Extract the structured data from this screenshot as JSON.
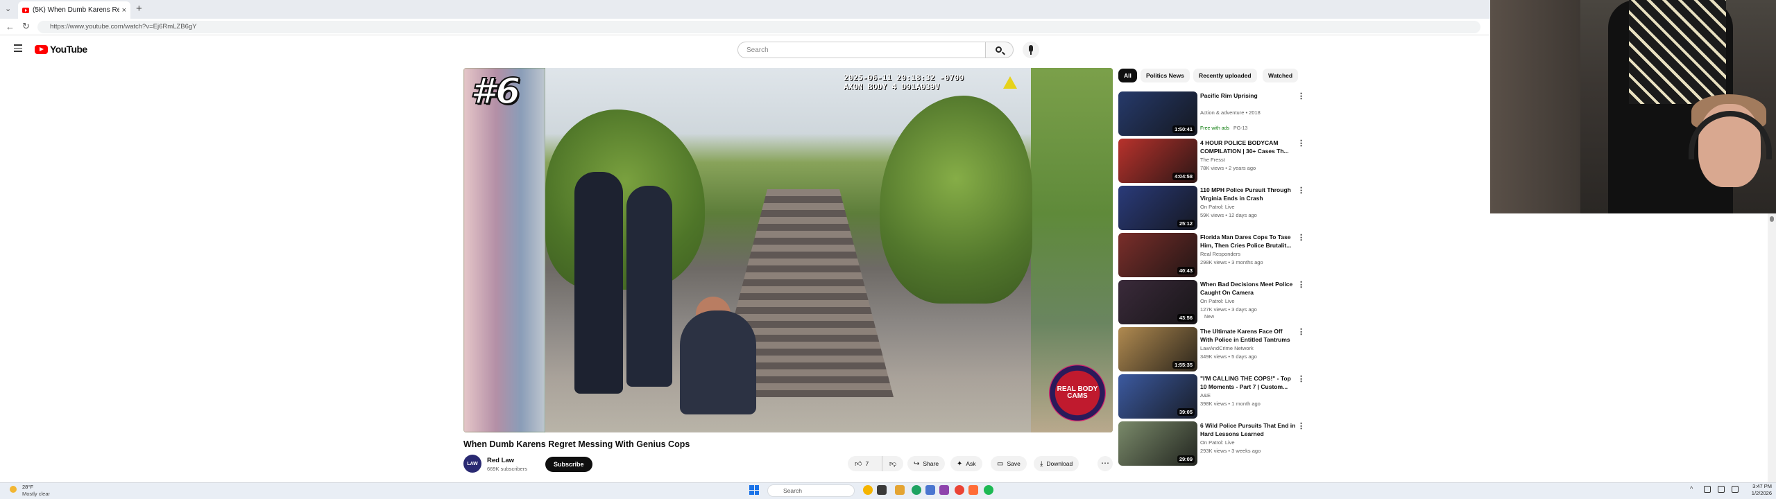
{
  "browser": {
    "tab_menu_glyph": "⌄",
    "active_tab_title": "(5K) When Dumb Karens Re...",
    "tab_close_glyph": "×",
    "new_tab_glyph": "+",
    "back_glyph": "←",
    "reload_glyph": "↻",
    "url": "https://www.youtube.com/watch?v=Ej6RmLZB6gY"
  },
  "youtube": {
    "logo_text": "YouTube",
    "search_placeholder": "Search",
    "video": {
      "rank_text": "#6",
      "overlay_text": "2025-06-11 20:18:32 -0700\nAXON BODY 4 D01A039V",
      "watermark_text": "REAL BODY CAMS",
      "title": "When Dumb Karens Regret Messing With Genius Cops",
      "channel_avatar_text": "LAW",
      "channel_name": "Red Law",
      "channel_subs": "669K subscribers",
      "subscribe_label": "Subscribe",
      "like_count": "7",
      "share_label": "Share",
      "ask_label": "Ask",
      "save_label": "Save",
      "download_label": "Download",
      "more_glyph": "⋯"
    },
    "chips": [
      "All",
      "Politics News",
      "Recently uploaded",
      "Watched"
    ],
    "recommendations": [
      {
        "title": "Pacific Rim Uprising",
        "channel": "Action & adventure • 2018",
        "meta": "",
        "badge_free": "Free with ads",
        "badge_extra": "PG-13",
        "duration": "1:50:41",
        "thumb_color": "#263a6b"
      },
      {
        "title": "4 HOUR POLICE BODYCAM COMPILATION | 30+ Cases Th...",
        "channel": "The Fresst",
        "meta": "78K views • 2 years ago",
        "badge_free": "",
        "badge_extra": "",
        "duration": "4:04:58",
        "thumb_color": "#b8322c"
      },
      {
        "title": "110 MPH Police Pursuit Through Virginia Ends in Crash",
        "channel": "On Patrol: Live",
        "meta": "59K views • 12 days ago",
        "badge_free": "",
        "badge_extra": "",
        "duration": "25:12",
        "thumb_color": "#2a3b7a"
      },
      {
        "title": "Florida Man Dares Cops To Tase Him, Then Cries Police Brutalit...",
        "channel": "Real Responders",
        "meta": "298K views • 3 months ago",
        "badge_free": "",
        "badge_extra": "",
        "duration": "40:43",
        "thumb_color": "#7a2e2a"
      },
      {
        "title": "When Bad Decisions Meet Police Caught On Camera",
        "channel": "On Patrol: Live",
        "meta": "127K views • 3 days ago",
        "badge_free": "",
        "badge_extra": "New",
        "duration": "43:56",
        "thumb_color": "#3a2a3a"
      },
      {
        "title": "The Ultimate Karens Face Off With Police in Entitled Tantrums",
        "channel": "LawAndCrime Network",
        "meta": "349K views • 5 days ago",
        "badge_free": "",
        "badge_extra": "",
        "duration": "1:55:35",
        "thumb_color": "#b08a50"
      },
      {
        "title": "\"I'M CALLING THE COPS!\" - Top 10 Moments - Part 7 | Custom...",
        "channel": "A&E",
        "meta": "398K views • 1 month ago",
        "badge_free": "",
        "badge_extra": "",
        "duration": "39:05",
        "thumb_color": "#3c5aa0"
      },
      {
        "title": "6 Wild Police Pursuits That End in Hard Lessons Learned",
        "channel": "On Patrol: Live",
        "meta": "293K views • 3 weeks ago",
        "badge_free": "",
        "badge_extra": "",
        "duration": "29:09",
        "thumb_color": "#7a8a6a"
      }
    ],
    "rec_more_glyph": "⋮"
  },
  "taskbar": {
    "weather_temp": "28°F",
    "weather_desc": "Mostly clear",
    "search_placeholder": "Search",
    "tray_chevron": "^",
    "clock_time": "3:47 PM",
    "clock_date": "1/2/2026"
  }
}
